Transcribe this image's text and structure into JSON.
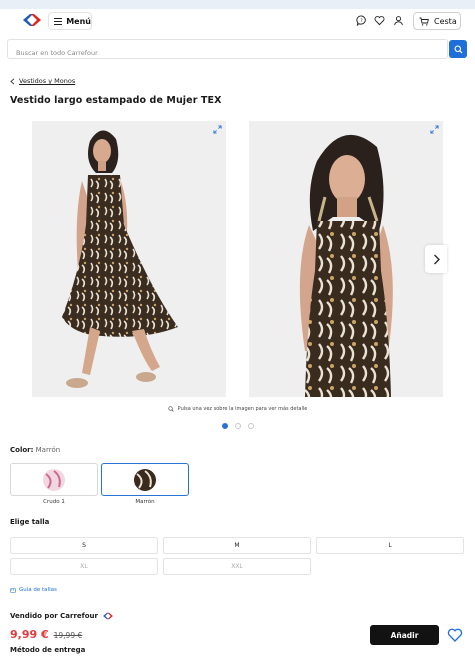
{
  "header": {
    "menu_label": "Menú",
    "cart_label": "Cesta",
    "brand_colors": {
      "blue": "#1e5bb8",
      "red": "#e2231a"
    }
  },
  "search": {
    "placeholder": "Buscar en todo Carrefour"
  },
  "breadcrumb": {
    "label": "Vestidos y Monos"
  },
  "product": {
    "title": "Vestido largo estampado de Mujer TEX",
    "gallery_hint": "Pulsa una vez sobre la imagen para ver más detalle",
    "gallery_index": 1,
    "gallery_count": 3
  },
  "color": {
    "label": "Color:",
    "selected": "Marrón",
    "options": [
      {
        "name": "Crudo 1",
        "swatch": "#f1d3de"
      },
      {
        "name": "Marrón",
        "swatch": "#3a2a1e"
      }
    ]
  },
  "sizes": {
    "label": "Elige talla",
    "options": [
      {
        "label": "S",
        "available": true
      },
      {
        "label": "M",
        "available": true
      },
      {
        "label": "L",
        "available": true
      },
      {
        "label": "XL",
        "available": false
      },
      {
        "label": "XXL",
        "available": false
      }
    ],
    "guide_label": "Guía de tallas"
  },
  "purchase": {
    "seller_label": "Vendido por Carrefour",
    "price": "9,99 €",
    "old_price": "19,99 €",
    "add_label": "Añadir",
    "delivery_label": "Método de entrega"
  },
  "colors": {
    "accent": "#2a73d6",
    "price": "#e03a3a",
    "button": "#121212"
  }
}
